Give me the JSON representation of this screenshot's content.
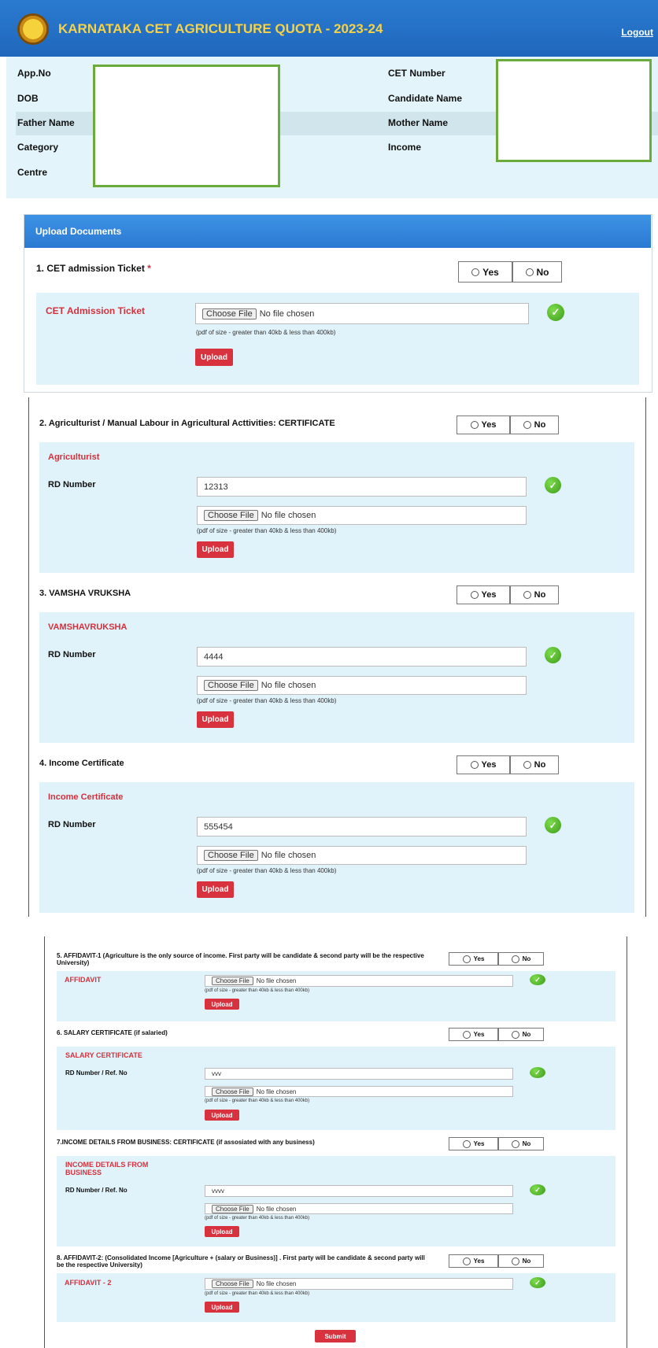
{
  "header": {
    "title": "KARNATAKA CET AGRICULTURE QUOTA - 2023-24",
    "logout": "Logout"
  },
  "info": {
    "app_no": "App.No",
    "dob": "DOB",
    "father_name": "Father Name",
    "category": "Category",
    "centre": "Centre",
    "cet_number": "CET Number",
    "candidate_name": "Candidate Name",
    "mother_name": "Mother Name",
    "income": "Income"
  },
  "upload_panel": {
    "title": "Upload Documents"
  },
  "common": {
    "yes": "Yes",
    "no": "No",
    "choose_file": "Choose File",
    "no_file": "No file chosen",
    "hint": "(pdf of size - greater than 40kb & less than 400kb)",
    "upload": "Upload",
    "rd_number": "RD Number",
    "rd_ref": "RD Number / Ref. No",
    "submit": "Submit",
    "required": "*"
  },
  "sections": [
    {
      "q": "1. CET admission Ticket",
      "sub": "CET Admission Ticket"
    },
    {
      "q": "2. Agriculturist / Manual Labour in Agricultural Acttivities: CERTIFICATE",
      "sub": "Agriculturist",
      "rd": "12313"
    },
    {
      "q": "3. VAMSHA VRUKSHA",
      "sub": "VAMSHAVRUKSHA",
      "rd": "4444"
    },
    {
      "q": "4. Income Certificate",
      "sub": "Income Certificate",
      "rd": "555454"
    },
    {
      "q": "5. AFFIDAVIT-1 (Agriculture is the only source of income. First party will be candidate & second party will be the respective University)",
      "sub": "AFFIDAVIT"
    },
    {
      "q": "6. SALARY CERTIFICATE (if salaried)",
      "sub": "SALARY CERTIFICATE",
      "rd": "vvv"
    },
    {
      "q": "7.INCOME DETAILS FROM BUSINESS: CERTIFICATE (if assosiated with any business)",
      "sub": "INCOME DETAILS FROM BUSINESS",
      "rd": "vvvv"
    },
    {
      "q": "8. AFFIDAVIT-2: (Consolidated Income [Agriculture + (salary or Business)] . First party will be candidate & second party will be the respective University)",
      "sub": "AFFIDAVIT - 2"
    }
  ]
}
